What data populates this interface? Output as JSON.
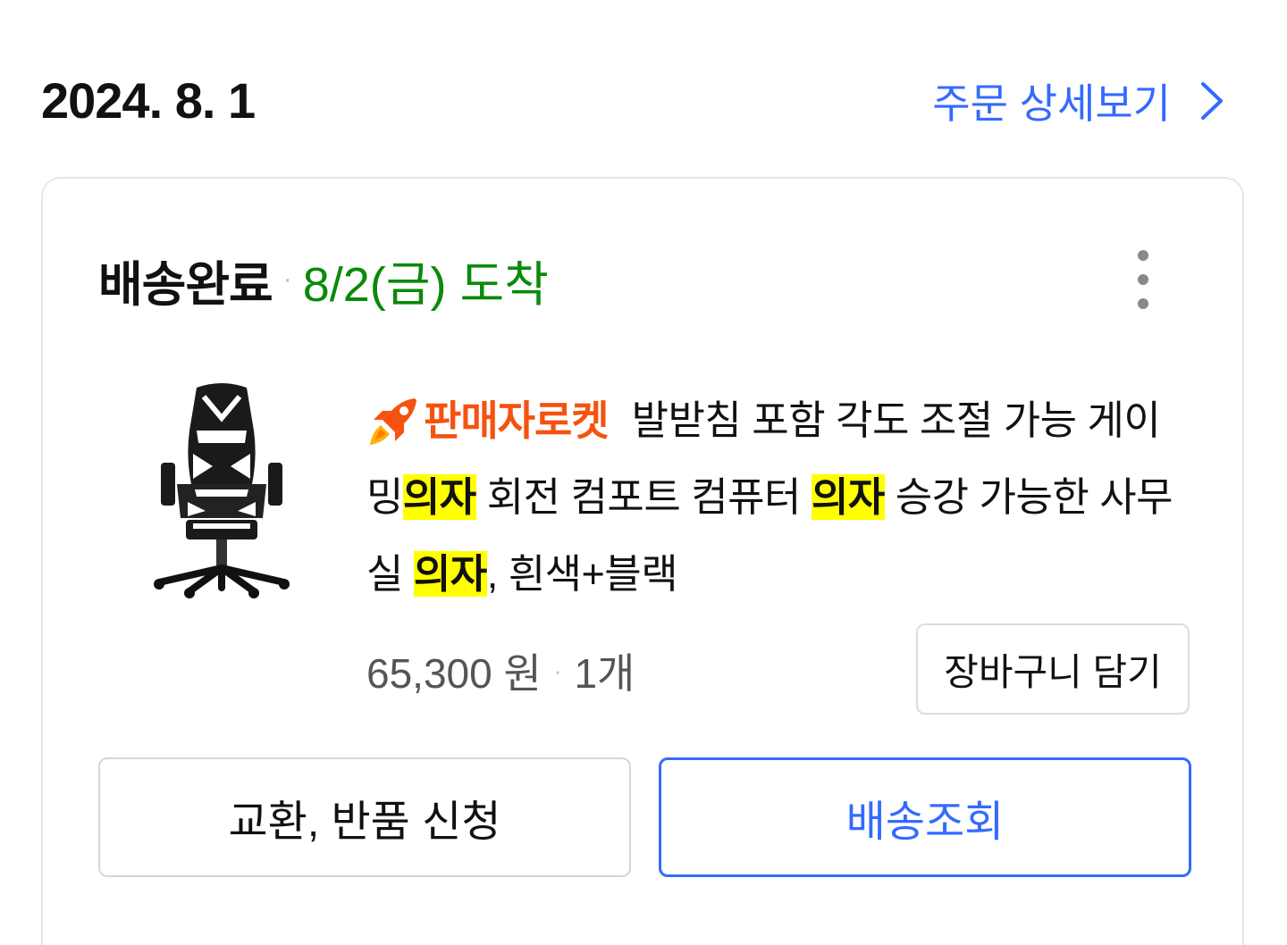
{
  "order": {
    "date": "2024. 8. 1",
    "detail_link_label": "주문 상세보기",
    "colors": {
      "link": "#346aff",
      "arrival": "#0a8a0a",
      "badge": "#f5520f",
      "highlight": "#ffff00"
    }
  },
  "shipment": {
    "status": "배송완료",
    "separator": "·",
    "arrival": "8/2(금) 도착",
    "more_icon": "more-vertical-icon"
  },
  "product": {
    "image_icon": "gaming-chair-image",
    "badge_label": "판매자로켓",
    "badge_icon": "rocket-icon",
    "title_parts": [
      "발받침 포함 각도 조절 가능 게이밍",
      "의자",
      " 회전 컴포트 컴퓨터 ",
      "의자",
      " 승강 가능한 사무실 ",
      "의자",
      ", 흰색+블랙"
    ],
    "price": "65,300 원",
    "separator": "·",
    "quantity": "1개",
    "cart_button_label": "장바구니 담기"
  },
  "actions": {
    "return_label": "교환, 반품 신청",
    "track_label": "배송조회"
  }
}
